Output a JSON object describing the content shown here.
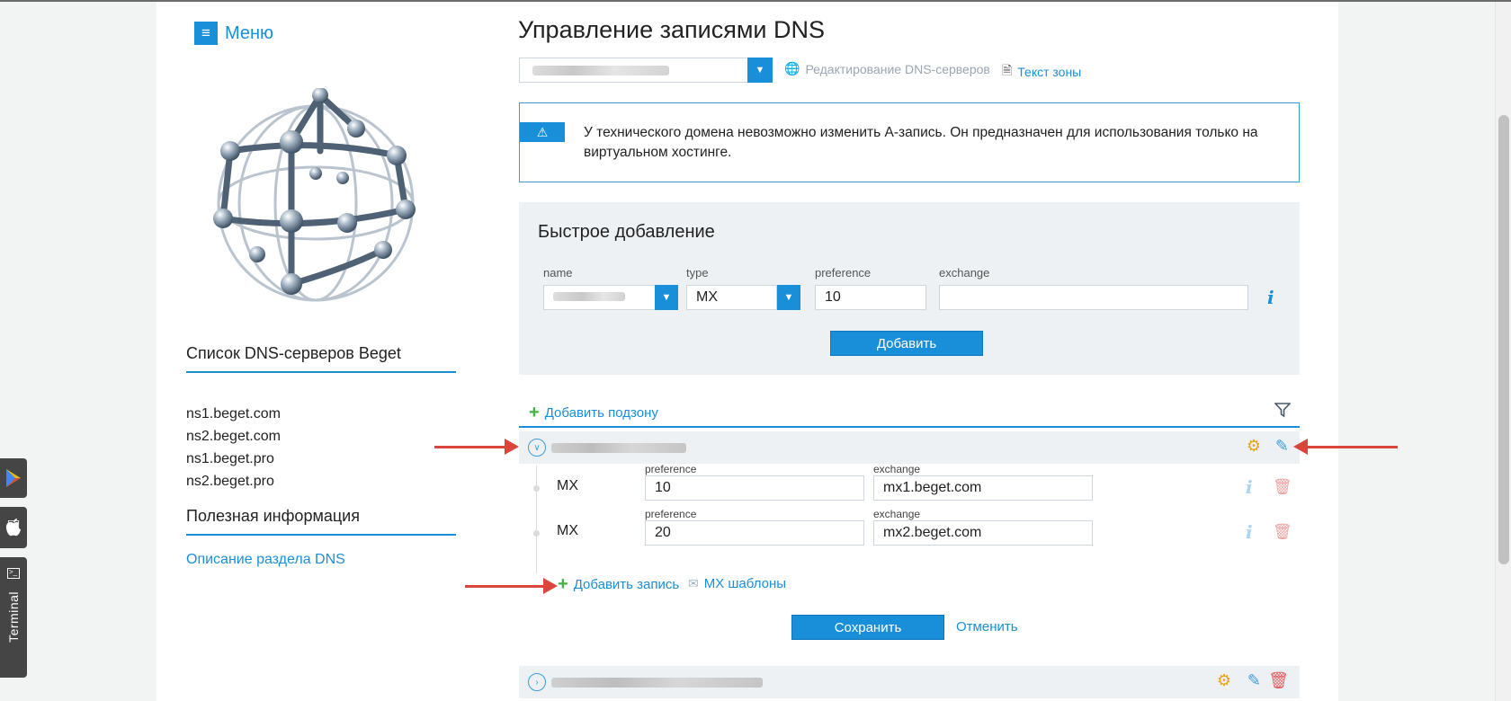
{
  "menu": {
    "icon": "hamburger-icon",
    "label": "Меню"
  },
  "sidebar": {
    "dns_servers_title": "Список DNS-серверов Beget",
    "dns_servers": [
      "ns1.beget.com",
      "ns2.beget.com",
      "ns1.beget.pro",
      "ns2.beget.pro"
    ],
    "info_title": "Полезная информация",
    "info_link": "Описание раздела DNS"
  },
  "side_tabs": {
    "terminal_label": "Terminal"
  },
  "header": {
    "title": "Управление записями DNS",
    "edit_dns_link": "Редактирование DNS-серверов",
    "zone_text_link": "Текст зоны"
  },
  "alert": {
    "text": "У технического домена невозможно изменить А-запись. Он предназначен для использования только на виртуальном хостинге."
  },
  "quick_add": {
    "title": "Быстрое добавление",
    "labels": {
      "name": "name",
      "type": "type",
      "preference": "preference",
      "exchange": "exchange"
    },
    "type_value": "MX",
    "preference_value": "10",
    "exchange_value": "",
    "add_button": "Добавить"
  },
  "records": {
    "add_subzone": "Добавить подзону",
    "rows": [
      {
        "type": "MX",
        "pref_label": "preference",
        "pref": "10",
        "exch_label": "exchange",
        "exch": "mx1.beget.com"
      },
      {
        "type": "MX",
        "pref_label": "preference",
        "pref": "20",
        "exch_label": "exchange",
        "exch": "mx2.beget.com"
      }
    ],
    "add_record": "Добавить запись",
    "mx_templates": "MX шаблоны",
    "save_button": "Сохранить",
    "cancel_link": "Отменить"
  },
  "colors": {
    "accent": "#1a8fd9",
    "panel": "#eef1f4",
    "annotation_arrow": "#d9463c"
  }
}
